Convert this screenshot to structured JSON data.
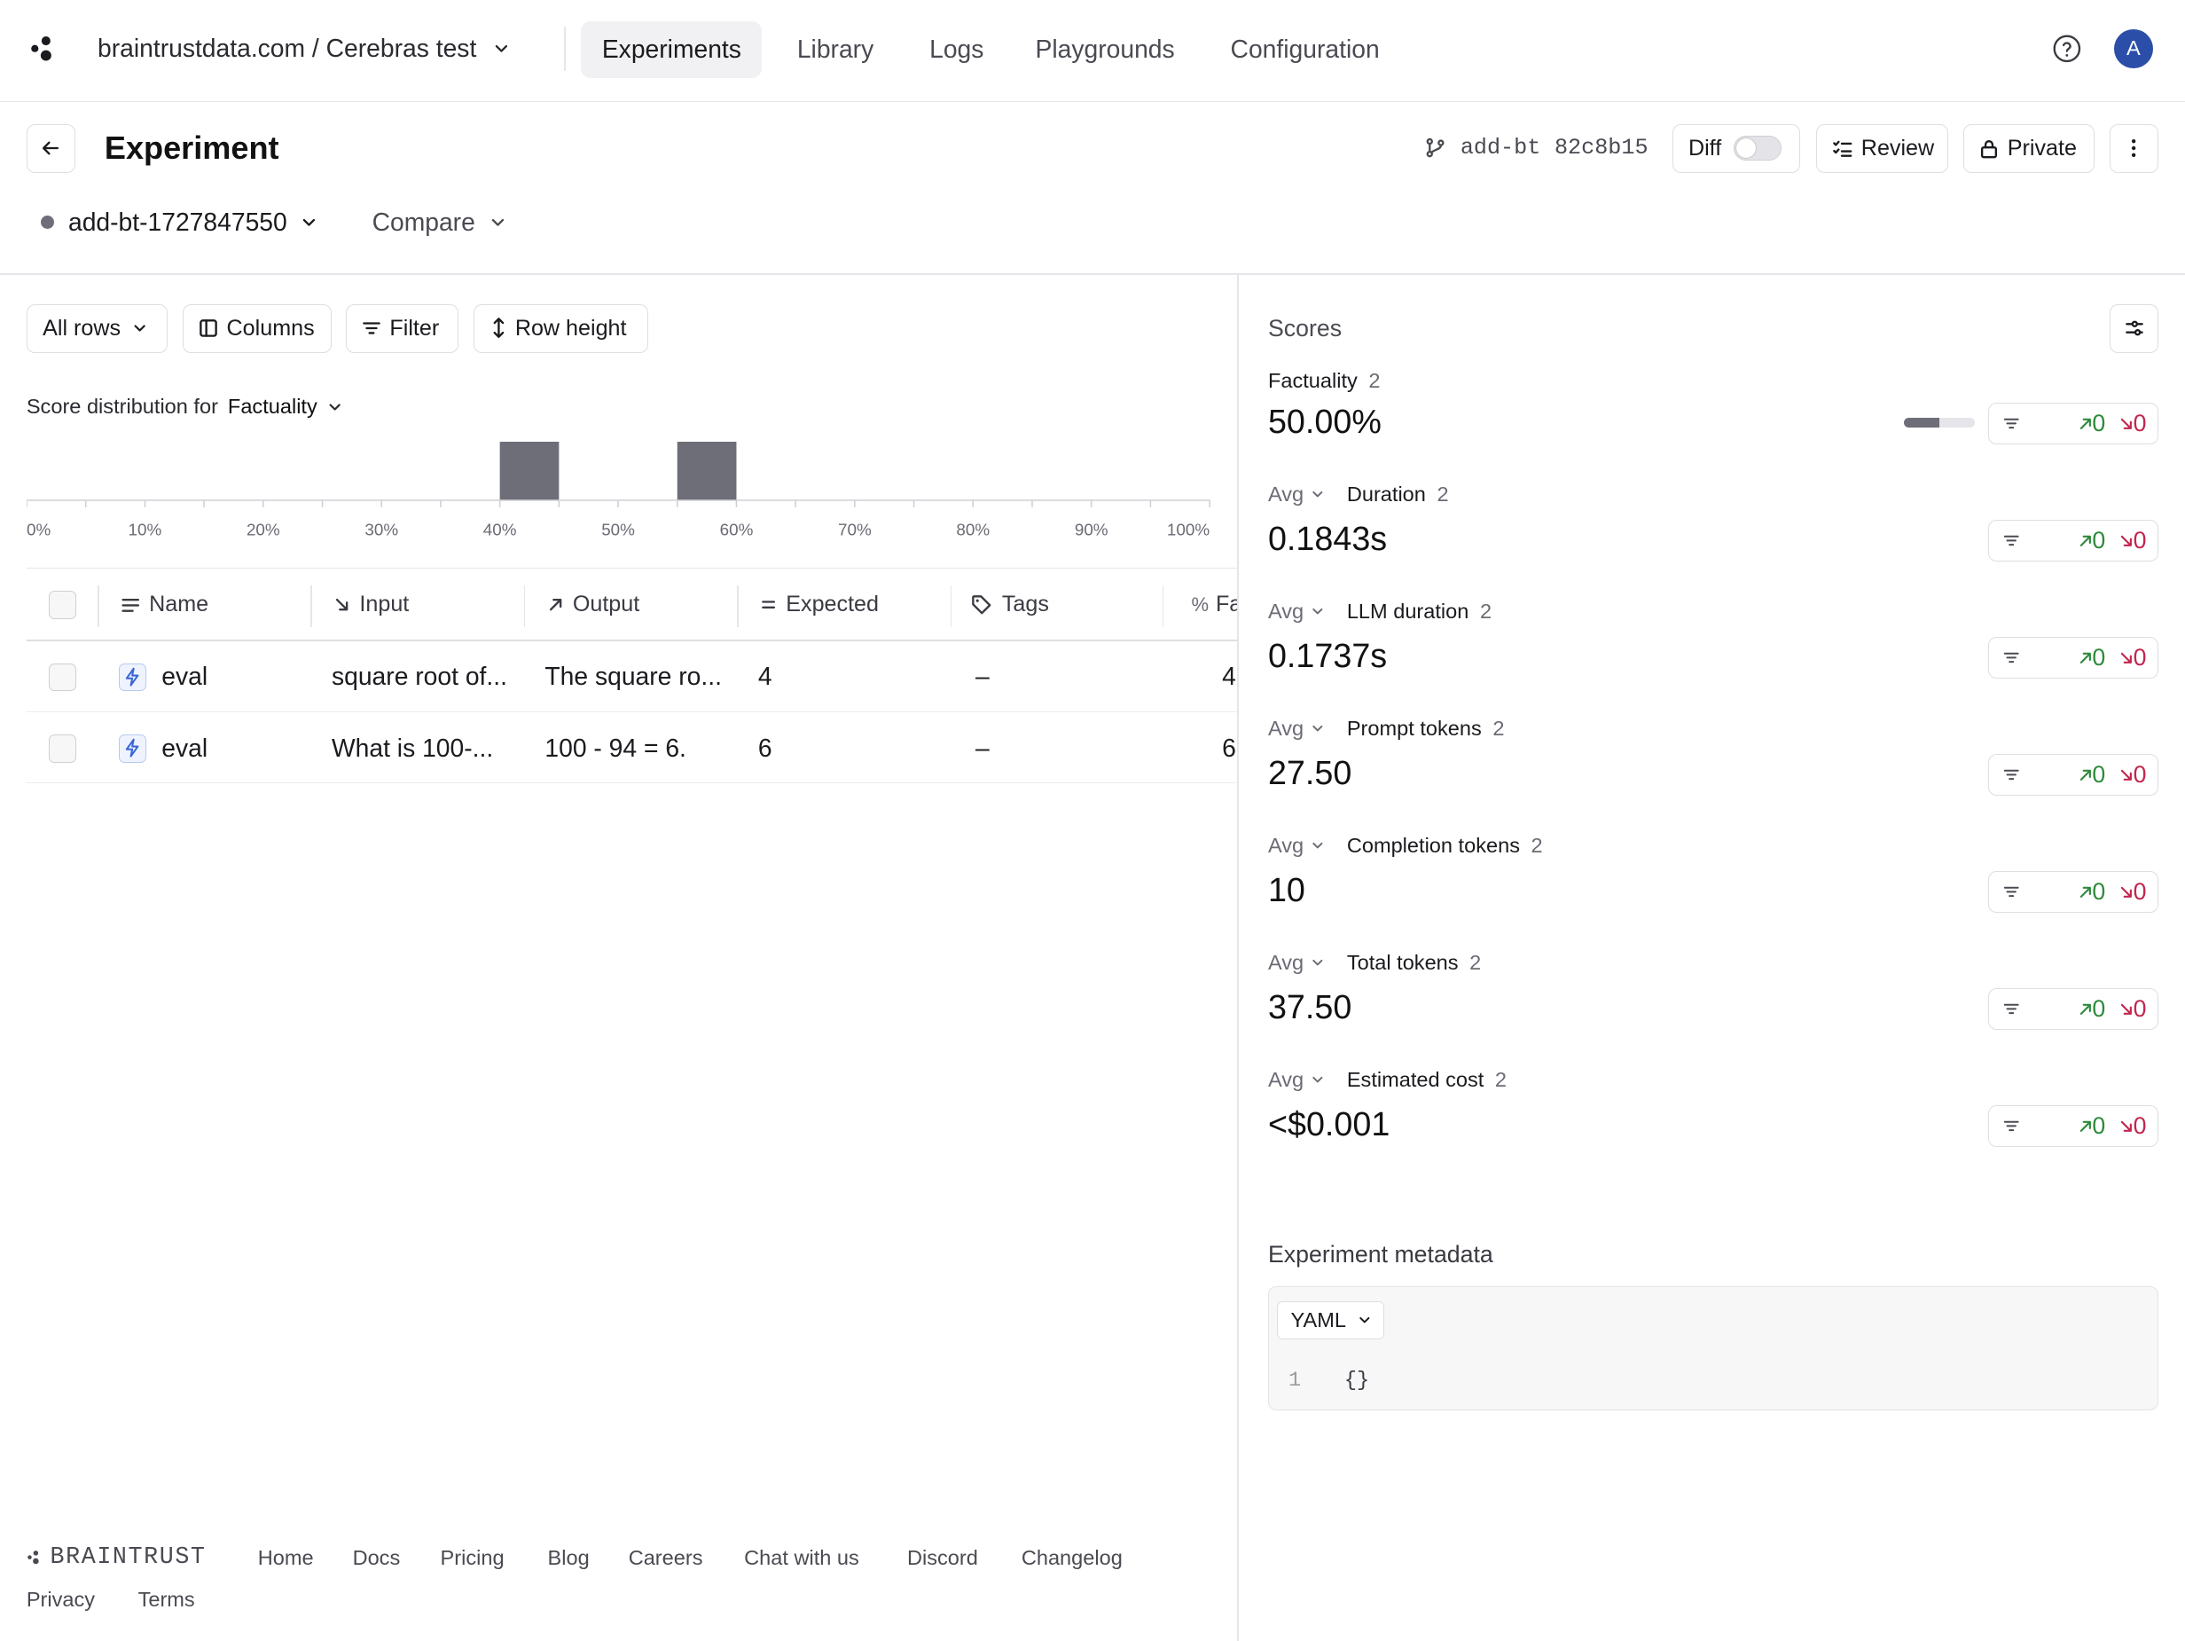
{
  "nav": {
    "breadcrumb": "braintrustdata.com / Cerebras test",
    "tabs": [
      "Experiments",
      "Library",
      "Logs",
      "Playgrounds",
      "Configuration"
    ],
    "avatar_initial": "A"
  },
  "header": {
    "title": "Experiment",
    "branch": "add-bt",
    "commit": "82c8b15",
    "diff_label": "Diff",
    "review_label": "Review",
    "private_label": "Private",
    "experiment_name": "add-bt-1727847550",
    "compare_label": "Compare"
  },
  "toolbar": {
    "all_rows": "All rows",
    "columns": "Columns",
    "filter": "Filter",
    "row_height": "Row height"
  },
  "distribution": {
    "label": "Score distribution for",
    "metric": "Factuality",
    "ticks": [
      "0%",
      "10%",
      "20%",
      "30%",
      "40%",
      "50%",
      "60%",
      "70%",
      "80%",
      "90%",
      "100%"
    ]
  },
  "chart_data": {
    "type": "bar",
    "title": "Score distribution for Factuality",
    "x_ticks": [
      "0%",
      "10%",
      "20%",
      "30%",
      "40%",
      "50%",
      "60%",
      "70%",
      "80%",
      "90%",
      "100%"
    ],
    "bins": [
      {
        "from": 40,
        "to": 45,
        "count": 1
      },
      {
        "from": 55,
        "to": 60,
        "count": 1
      }
    ],
    "xlim": [
      0,
      100
    ]
  },
  "table": {
    "headers": [
      "Name",
      "Input",
      "Output",
      "Expected",
      "Tags",
      "Fa"
    ],
    "rows": [
      {
        "name": "eval",
        "input": "square root of...",
        "output": "The square ro...",
        "expected": "4",
        "tags": "–",
        "score": "4"
      },
      {
        "name": "eval",
        "input": "What is 100-...",
        "output": "100 - 94 = 6.",
        "expected": "6",
        "tags": "–",
        "score": "6"
      }
    ]
  },
  "scores": {
    "title": "Scores",
    "factuality": {
      "label": "Factuality",
      "count": "2",
      "value": "50.00%",
      "progress": 0.5,
      "up": "0",
      "down": "0"
    },
    "metrics": [
      {
        "agg": "Avg",
        "label": "Duration",
        "count": "2",
        "value": "0.1843s",
        "up": "0",
        "down": "0"
      },
      {
        "agg": "Avg",
        "label": "LLM duration",
        "count": "2",
        "value": "0.1737s",
        "up": "0",
        "down": "0"
      },
      {
        "agg": "Avg",
        "label": "Prompt tokens",
        "count": "2",
        "value": "27.50",
        "up": "0",
        "down": "0"
      },
      {
        "agg": "Avg",
        "label": "Completion tokens",
        "count": "2",
        "value": "10",
        "up": "0",
        "down": "0"
      },
      {
        "agg": "Avg",
        "label": "Total tokens",
        "count": "2",
        "value": "37.50",
        "up": "0",
        "down": "0"
      },
      {
        "agg": "Avg",
        "label": "Estimated cost",
        "count": "2",
        "value": "<$0.001",
        "up": "0",
        "down": "0"
      }
    ]
  },
  "metadata": {
    "title": "Experiment metadata",
    "format": "YAML",
    "line_number": "1",
    "content": "{}"
  },
  "footer": {
    "brand": "BRAINTRUST",
    "links": [
      "Home",
      "Docs",
      "Pricing",
      "Blog",
      "Careers",
      "Chat with us",
      "Discord",
      "Changelog"
    ],
    "links2": [
      "Privacy",
      "Terms"
    ]
  },
  "colors": {
    "accent": "#2b4ea8",
    "bar": "#6e6e78",
    "up": "#2e8a3b",
    "down": "#c2264e"
  }
}
